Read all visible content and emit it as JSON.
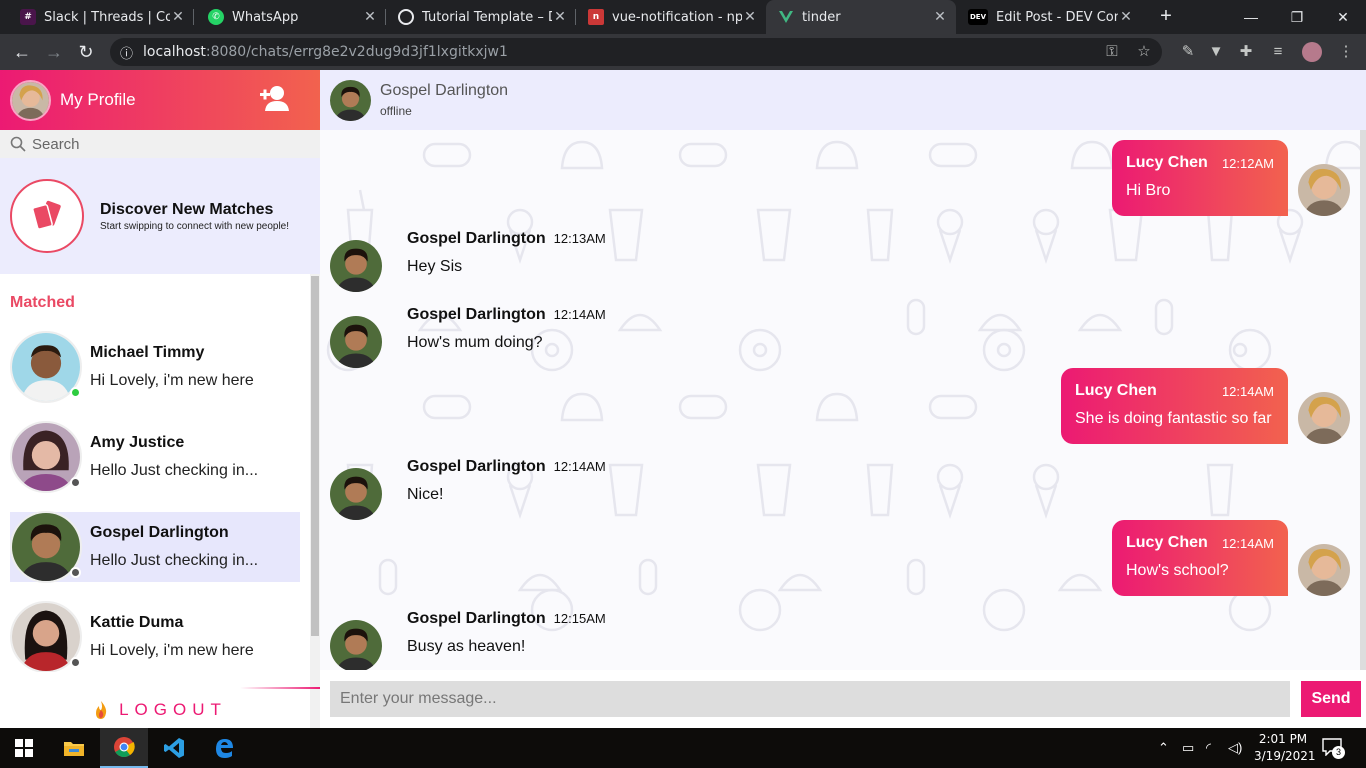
{
  "browser": {
    "tabs": [
      {
        "title": "Slack | Threads | CometChat",
        "icon": "slack-icon",
        "color": "#4a154b"
      },
      {
        "title": "WhatsApp",
        "icon": "whatsapp-icon",
        "color": "#25d366"
      },
      {
        "title": "Tutorial Template – Drop",
        "icon": "globe-icon",
        "color": "#5f6368"
      },
      {
        "title": "vue-notification - npm",
        "icon": "npm-icon",
        "color": "#cb3837"
      },
      {
        "title": "tinder",
        "icon": "vue-icon",
        "color": "#41b883"
      },
      {
        "title": "Edit Post - DEV Community",
        "icon": "dev-icon",
        "color": "#000000"
      }
    ],
    "active_tab": 4,
    "url_host": "localhost",
    "url_path": ":8080/chats/errg8e2v2dug9d3jf1lxgitkxjw1"
  },
  "sidebar": {
    "profile_title": "My Profile",
    "search_placeholder": "Search",
    "discover_title": "Discover New Matches",
    "discover_subtitle": "Start swipping to connect with new people!",
    "matched_title": "Matched",
    "matches": [
      {
        "name": "Michael Timmy",
        "message": "Hi Lovely, i'm new here",
        "online": true
      },
      {
        "name": "Amy Justice",
        "message": "Hello Just checking in...",
        "online": false
      },
      {
        "name": "Gospel Darlington",
        "message": "Hello Just checking in...",
        "online": false,
        "selected": true
      },
      {
        "name": "Kattie Duma",
        "message": "Hi Lovely, i'm new here",
        "online": false
      }
    ],
    "logout_label": "LOGOUT"
  },
  "chat": {
    "partner_name": "Gospel Darlington",
    "partner_status": "offline",
    "messages": [
      {
        "side": "right",
        "author": "Lucy Chen",
        "time": "12:12AM",
        "text": "Hi Bro"
      },
      {
        "side": "left",
        "author": "Gospel Darlington",
        "time": "12:13AM",
        "text": "Hey Sis"
      },
      {
        "side": "left",
        "author": "Gospel Darlington",
        "time": "12:14AM",
        "text": "How's mum doing?"
      },
      {
        "side": "right",
        "author": "Lucy Chen",
        "time": "12:14AM",
        "text": "She is doing fantastic so far"
      },
      {
        "side": "left",
        "author": "Gospel Darlington",
        "time": "12:14AM",
        "text": "Nice!"
      },
      {
        "side": "right",
        "author": "Lucy Chen",
        "time": "12:14AM",
        "text": "How's school?"
      },
      {
        "side": "left",
        "author": "Gospel Darlington",
        "time": "12:15AM",
        "text": "Busy as heaven!"
      }
    ],
    "input_placeholder": "Enter your message...",
    "send_label": "Send"
  },
  "taskbar": {
    "time": "2:01 PM",
    "date": "3/19/2021",
    "notifications": "3"
  },
  "colors": {
    "accent": "#ec1a73",
    "accent_end": "#f2624e",
    "panel": "#ececfd",
    "online": "#2ecc40",
    "offline": "#555555"
  }
}
